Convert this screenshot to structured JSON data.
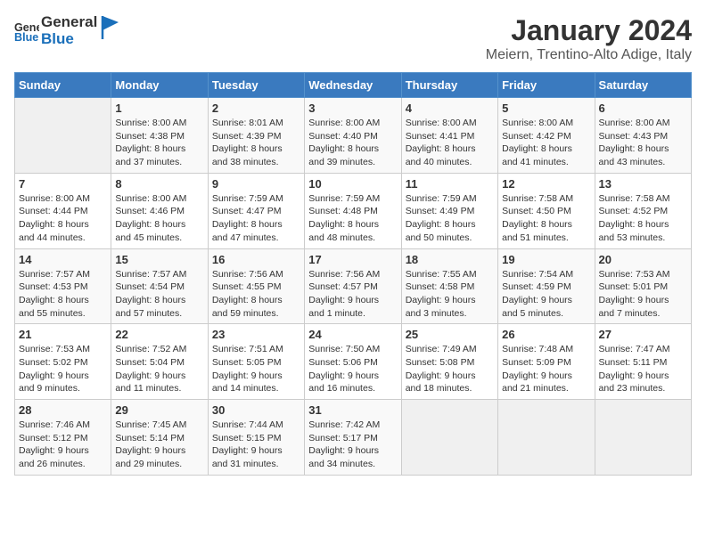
{
  "header": {
    "logo_general": "General",
    "logo_blue": "Blue",
    "month": "January 2024",
    "location": "Meiern, Trentino-Alto Adige, Italy"
  },
  "days_of_week": [
    "Sunday",
    "Monday",
    "Tuesday",
    "Wednesday",
    "Thursday",
    "Friday",
    "Saturday"
  ],
  "weeks": [
    [
      {
        "day": "",
        "info": ""
      },
      {
        "day": "1",
        "info": "Sunrise: 8:00 AM\nSunset: 4:38 PM\nDaylight: 8 hours\nand 37 minutes."
      },
      {
        "day": "2",
        "info": "Sunrise: 8:01 AM\nSunset: 4:39 PM\nDaylight: 8 hours\nand 38 minutes."
      },
      {
        "day": "3",
        "info": "Sunrise: 8:00 AM\nSunset: 4:40 PM\nDaylight: 8 hours\nand 39 minutes."
      },
      {
        "day": "4",
        "info": "Sunrise: 8:00 AM\nSunset: 4:41 PM\nDaylight: 8 hours\nand 40 minutes."
      },
      {
        "day": "5",
        "info": "Sunrise: 8:00 AM\nSunset: 4:42 PM\nDaylight: 8 hours\nand 41 minutes."
      },
      {
        "day": "6",
        "info": "Sunrise: 8:00 AM\nSunset: 4:43 PM\nDaylight: 8 hours\nand 43 minutes."
      }
    ],
    [
      {
        "day": "7",
        "info": "Sunrise: 8:00 AM\nSunset: 4:44 PM\nDaylight: 8 hours\nand 44 minutes."
      },
      {
        "day": "8",
        "info": "Sunrise: 8:00 AM\nSunset: 4:46 PM\nDaylight: 8 hours\nand 45 minutes."
      },
      {
        "day": "9",
        "info": "Sunrise: 7:59 AM\nSunset: 4:47 PM\nDaylight: 8 hours\nand 47 minutes."
      },
      {
        "day": "10",
        "info": "Sunrise: 7:59 AM\nSunset: 4:48 PM\nDaylight: 8 hours\nand 48 minutes."
      },
      {
        "day": "11",
        "info": "Sunrise: 7:59 AM\nSunset: 4:49 PM\nDaylight: 8 hours\nand 50 minutes."
      },
      {
        "day": "12",
        "info": "Sunrise: 7:58 AM\nSunset: 4:50 PM\nDaylight: 8 hours\nand 51 minutes."
      },
      {
        "day": "13",
        "info": "Sunrise: 7:58 AM\nSunset: 4:52 PM\nDaylight: 8 hours\nand 53 minutes."
      }
    ],
    [
      {
        "day": "14",
        "info": "Sunrise: 7:57 AM\nSunset: 4:53 PM\nDaylight: 8 hours\nand 55 minutes."
      },
      {
        "day": "15",
        "info": "Sunrise: 7:57 AM\nSunset: 4:54 PM\nDaylight: 8 hours\nand 57 minutes."
      },
      {
        "day": "16",
        "info": "Sunrise: 7:56 AM\nSunset: 4:55 PM\nDaylight: 8 hours\nand 59 minutes."
      },
      {
        "day": "17",
        "info": "Sunrise: 7:56 AM\nSunset: 4:57 PM\nDaylight: 9 hours\nand 1 minute."
      },
      {
        "day": "18",
        "info": "Sunrise: 7:55 AM\nSunset: 4:58 PM\nDaylight: 9 hours\nand 3 minutes."
      },
      {
        "day": "19",
        "info": "Sunrise: 7:54 AM\nSunset: 4:59 PM\nDaylight: 9 hours\nand 5 minutes."
      },
      {
        "day": "20",
        "info": "Sunrise: 7:53 AM\nSunset: 5:01 PM\nDaylight: 9 hours\nand 7 minutes."
      }
    ],
    [
      {
        "day": "21",
        "info": "Sunrise: 7:53 AM\nSunset: 5:02 PM\nDaylight: 9 hours\nand 9 minutes."
      },
      {
        "day": "22",
        "info": "Sunrise: 7:52 AM\nSunset: 5:04 PM\nDaylight: 9 hours\nand 11 minutes."
      },
      {
        "day": "23",
        "info": "Sunrise: 7:51 AM\nSunset: 5:05 PM\nDaylight: 9 hours\nand 14 minutes."
      },
      {
        "day": "24",
        "info": "Sunrise: 7:50 AM\nSunset: 5:06 PM\nDaylight: 9 hours\nand 16 minutes."
      },
      {
        "day": "25",
        "info": "Sunrise: 7:49 AM\nSunset: 5:08 PM\nDaylight: 9 hours\nand 18 minutes."
      },
      {
        "day": "26",
        "info": "Sunrise: 7:48 AM\nSunset: 5:09 PM\nDaylight: 9 hours\nand 21 minutes."
      },
      {
        "day": "27",
        "info": "Sunrise: 7:47 AM\nSunset: 5:11 PM\nDaylight: 9 hours\nand 23 minutes."
      }
    ],
    [
      {
        "day": "28",
        "info": "Sunrise: 7:46 AM\nSunset: 5:12 PM\nDaylight: 9 hours\nand 26 minutes."
      },
      {
        "day": "29",
        "info": "Sunrise: 7:45 AM\nSunset: 5:14 PM\nDaylight: 9 hours\nand 29 minutes."
      },
      {
        "day": "30",
        "info": "Sunrise: 7:44 AM\nSunset: 5:15 PM\nDaylight: 9 hours\nand 31 minutes."
      },
      {
        "day": "31",
        "info": "Sunrise: 7:42 AM\nSunset: 5:17 PM\nDaylight: 9 hours\nand 34 minutes."
      },
      {
        "day": "",
        "info": ""
      },
      {
        "day": "",
        "info": ""
      },
      {
        "day": "",
        "info": ""
      }
    ]
  ]
}
